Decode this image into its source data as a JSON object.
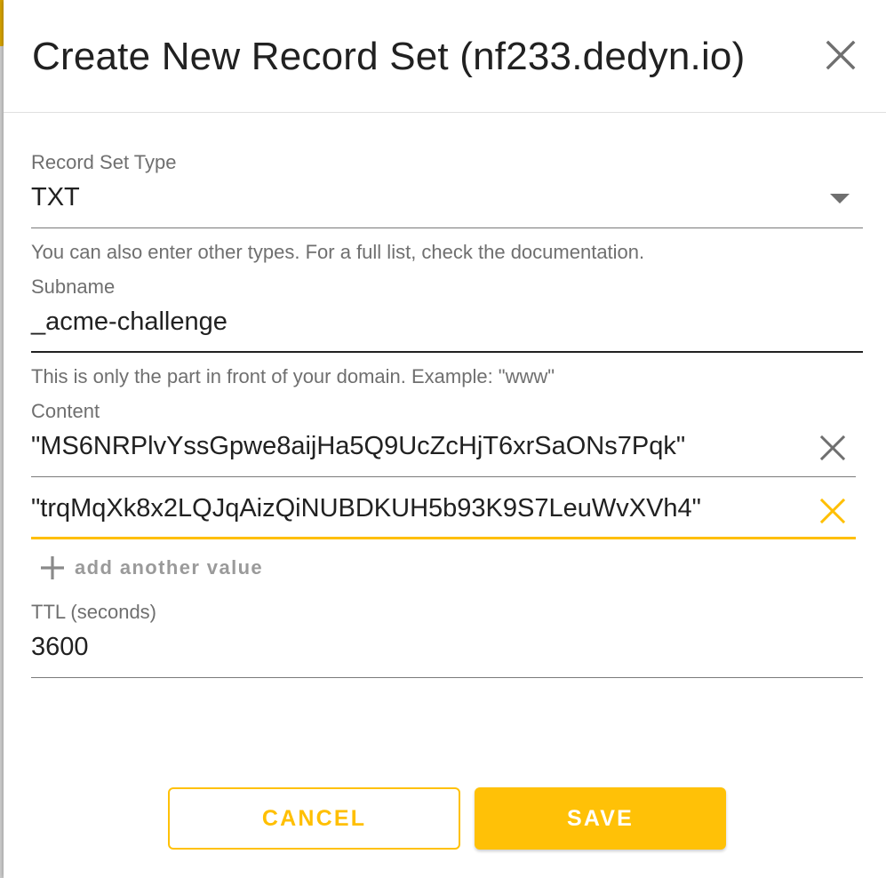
{
  "dialog": {
    "title": "Create New Record Set (nf233.dedyn.io)"
  },
  "fields": {
    "type": {
      "label": "Record Set Type",
      "value": "TXT",
      "hint": "You can also enter other types. For a full list, check the documentation."
    },
    "subname": {
      "label": "Subname",
      "value": "_acme-challenge",
      "hint": "This is only the part in front of your domain. Example: \"www\""
    },
    "content": {
      "label": "Content",
      "values": [
        "\"MS6NRPlvYssGpwe8aijHa5Q9UcZcHjT6xrSaONs7Pqk\"",
        "\"trqMqXk8x2LQJqAizQiNUBDKUH5b93K9S7LeuWvXVh4\""
      ],
      "add_label": "add another value"
    },
    "ttl": {
      "label": "TTL (seconds)",
      "value": "3600"
    }
  },
  "actions": {
    "cancel_label": "CANCEL",
    "save_label": "SAVE"
  },
  "colors": {
    "accent": "#ffc107",
    "text": "#212121",
    "muted": "#6f6f6f"
  },
  "icons": {
    "close": "close-icon",
    "clear": "clear-icon",
    "add": "plus-icon",
    "dropdown": "chevron-down-icon"
  }
}
